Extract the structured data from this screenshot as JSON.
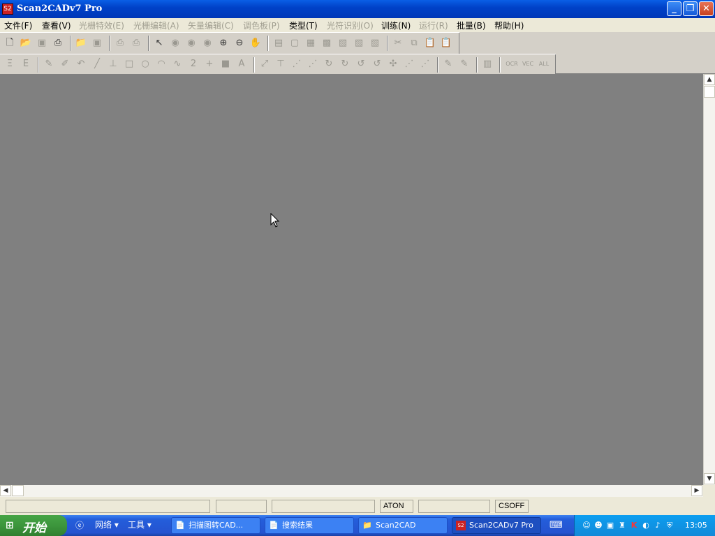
{
  "window": {
    "title": "Scan2CADv7 Pro",
    "icon": "app-icon",
    "icon_glyph": "S2",
    "buttons": {
      "minimize": "_",
      "maximize": "❐",
      "close": "✕"
    }
  },
  "menubar": {
    "items": [
      {
        "label": "文件(F)",
        "enabled": true
      },
      {
        "label": "查看(V)",
        "enabled": true
      },
      {
        "label": "光栅特效(E)",
        "enabled": false
      },
      {
        "label": "光栅编辑(A)",
        "enabled": false
      },
      {
        "label": "矢量编辑(C)",
        "enabled": false
      },
      {
        "label": "调色板(P)",
        "enabled": false
      },
      {
        "label": "类型(T)",
        "enabled": true
      },
      {
        "label": "光符识别(O)",
        "enabled": false
      },
      {
        "label": "训练(N)",
        "enabled": true
      },
      {
        "label": "运行(R)",
        "enabled": false
      },
      {
        "label": "批量(B)",
        "enabled": true
      },
      {
        "label": "帮助(H)",
        "enabled": true
      }
    ]
  },
  "toolbar1": {
    "icons": [
      "new-file-icon",
      "open-file-icon",
      "save-icon",
      "scan-icon",
      "open-folder-icon",
      "save-as-icon",
      "print-icon",
      "print-preview-icon",
      "select-arrow-icon",
      "view-eye-icon",
      "view-eye2-icon",
      "view-eye3-icon",
      "zoom-in-icon",
      "zoom-out-icon",
      "pan-hand-icon",
      "grid1-icon",
      "grid2-icon",
      "grid3-icon",
      "grid4-icon",
      "grid5-icon",
      "grid6-icon",
      "grid7-icon",
      "cut-icon",
      "copy-icon",
      "paste-icon"
    ]
  },
  "toolbar2": {
    "icons": [
      "eraser-left-icon",
      "eraser-right-icon",
      "pencil-icon",
      "brush-icon",
      "undo-arc-icon",
      "line-icon",
      "perpendicular-icon",
      "rectangle-icon",
      "circle-icon",
      "arc-icon",
      "spline-icon",
      "number-icon",
      "point-icon",
      "fill-square-icon",
      "text-icon",
      "vec-line-icon",
      "vec-dim-icon",
      "vec-node1-icon",
      "vec-node2-icon",
      "vec-node3-icon",
      "vec-node4-icon",
      "vec-node5-icon",
      "vec-node6-icon",
      "vec-node7-icon",
      "vec-node8-icon",
      "vec-node9-icon",
      "edit-pen-icon",
      "edit-pen2-icon",
      "layout-icon"
    ],
    "text_buttons": [
      "OCR",
      "VEC",
      "ALL"
    ]
  },
  "statusbar": {
    "panes": [
      "",
      "",
      "",
      "ATON",
      "",
      "CSOFF"
    ]
  },
  "taskbar": {
    "start_label": "开始",
    "quicklaunch": [
      "网络 ▾",
      "工具 ▾"
    ],
    "tasks": [
      {
        "label": "扫描图转CAD...",
        "icon": "document-icon",
        "active": false
      },
      {
        "label": "搜索结果",
        "icon": "search-results-icon",
        "active": false
      },
      {
        "label": "Scan2CAD",
        "icon": "folder-icon",
        "active": false
      },
      {
        "label": "Scan2CADv7 Pro",
        "icon": "app-icon",
        "active": true
      }
    ],
    "clock": "13:05",
    "tray_icons": [
      "keyboard-icon",
      "qq-icon",
      "messenger-icon",
      "network-icon",
      "antivirus-icon",
      "k-icon",
      "speaker-icon",
      "volume-icon",
      "shield-icon"
    ]
  }
}
